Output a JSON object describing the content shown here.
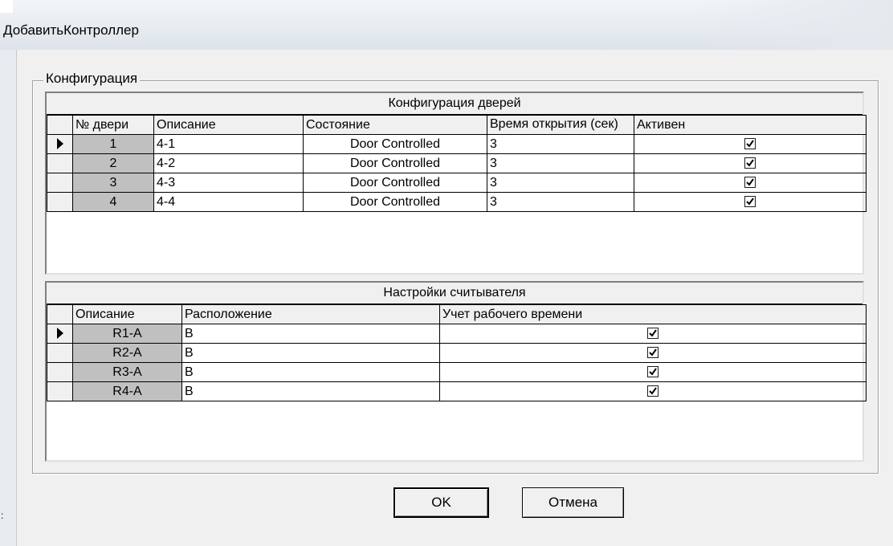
{
  "window": {
    "title": "ДобавитьКонтроллер"
  },
  "group": {
    "legend": "Конфигурация"
  },
  "doors": {
    "caption": "Конфигурация дверей",
    "columns": [
      "№ двери",
      "Описание",
      "Состояние",
      "Время открытия (сек)",
      "Активен"
    ],
    "rows": [
      {
        "num": "1",
        "desc": "4-1",
        "state": "Door Controlled",
        "time": "3",
        "active": true,
        "current": true
      },
      {
        "num": "2",
        "desc": "4-2",
        "state": "Door Controlled",
        "time": "3",
        "active": true,
        "current": false
      },
      {
        "num": "3",
        "desc": "4-3",
        "state": "Door Controlled",
        "time": "3",
        "active": true,
        "current": false
      },
      {
        "num": "4",
        "desc": "4-4",
        "state": "Door Controlled",
        "time": "3",
        "active": true,
        "current": false
      }
    ]
  },
  "readers": {
    "caption": "Настройки считывателя",
    "columns": [
      "Описание",
      "Расположение",
      "Учет рабочего времени"
    ],
    "rows": [
      {
        "desc": "R1-A",
        "location": "B",
        "timekeeping": true,
        "current": true
      },
      {
        "desc": "R2-A",
        "location": "B",
        "timekeeping": true,
        "current": false
      },
      {
        "desc": "R3-A",
        "location": "B",
        "timekeeping": true,
        "current": false
      },
      {
        "desc": "R4-A",
        "location": "B",
        "timekeeping": true,
        "current": false
      }
    ]
  },
  "buttons": {
    "ok": "OK",
    "cancel": "Отмена"
  },
  "icons": {
    "row_indicator": "row-pointer-icon",
    "checkbox": "checkmark-icon"
  }
}
